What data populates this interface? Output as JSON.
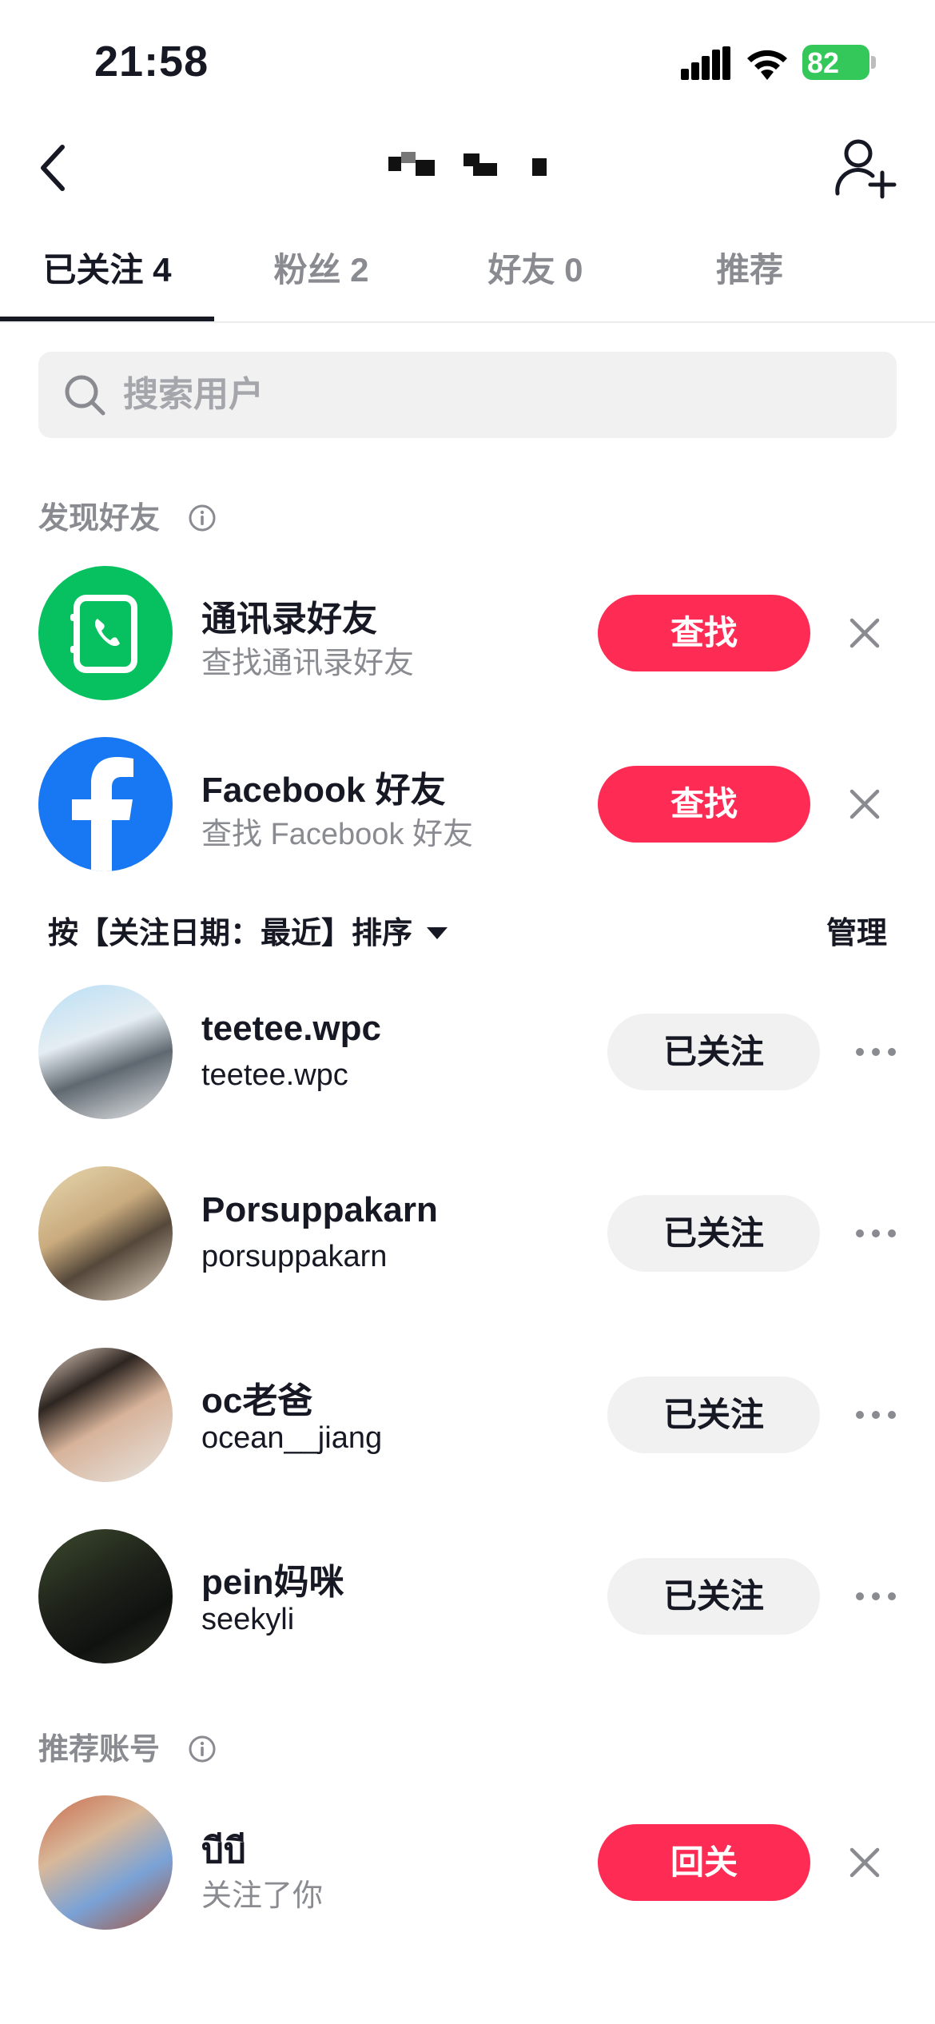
{
  "status_bar": {
    "time": "21:58",
    "battery": "82"
  },
  "tabs": [
    {
      "label": "已关注 4"
    },
    {
      "label": "粉丝 2"
    },
    {
      "label": "好友 0"
    },
    {
      "label": "推荐"
    }
  ],
  "search": {
    "placeholder": "搜索用户",
    "value": ""
  },
  "discover": {
    "header": "发现好友",
    "items": [
      {
        "title": "通讯录好友",
        "subtitle": "查找通讯录好友",
        "button": "查找"
      },
      {
        "title": "Facebook 好友",
        "subtitle": "查找 Facebook 好友",
        "button": "查找"
      }
    ]
  },
  "sort": {
    "label": "按【关注日期：最近】排序",
    "manage": "管理"
  },
  "following": {
    "button_label": "已关注",
    "users": [
      {
        "name": "teetee.wpc",
        "handle": "teetee.wpc"
      },
      {
        "name": "Porsuppakarn",
        "handle": "porsuppakarn"
      },
      {
        "name": "oc老爸",
        "handle": "ocean__jiang"
      },
      {
        "name": "pein妈咪",
        "handle": "seekyli"
      }
    ]
  },
  "recommended": {
    "header": "推荐账号",
    "users": [
      {
        "name": "บีบี",
        "subtitle": "关注了你",
        "button": "回关"
      }
    ]
  },
  "colors": {
    "accent": "#fe2c55",
    "text": "#161823",
    "secondary": "#8a8b91",
    "contacts_green": "#07c160",
    "facebook_blue": "#1877f2"
  }
}
